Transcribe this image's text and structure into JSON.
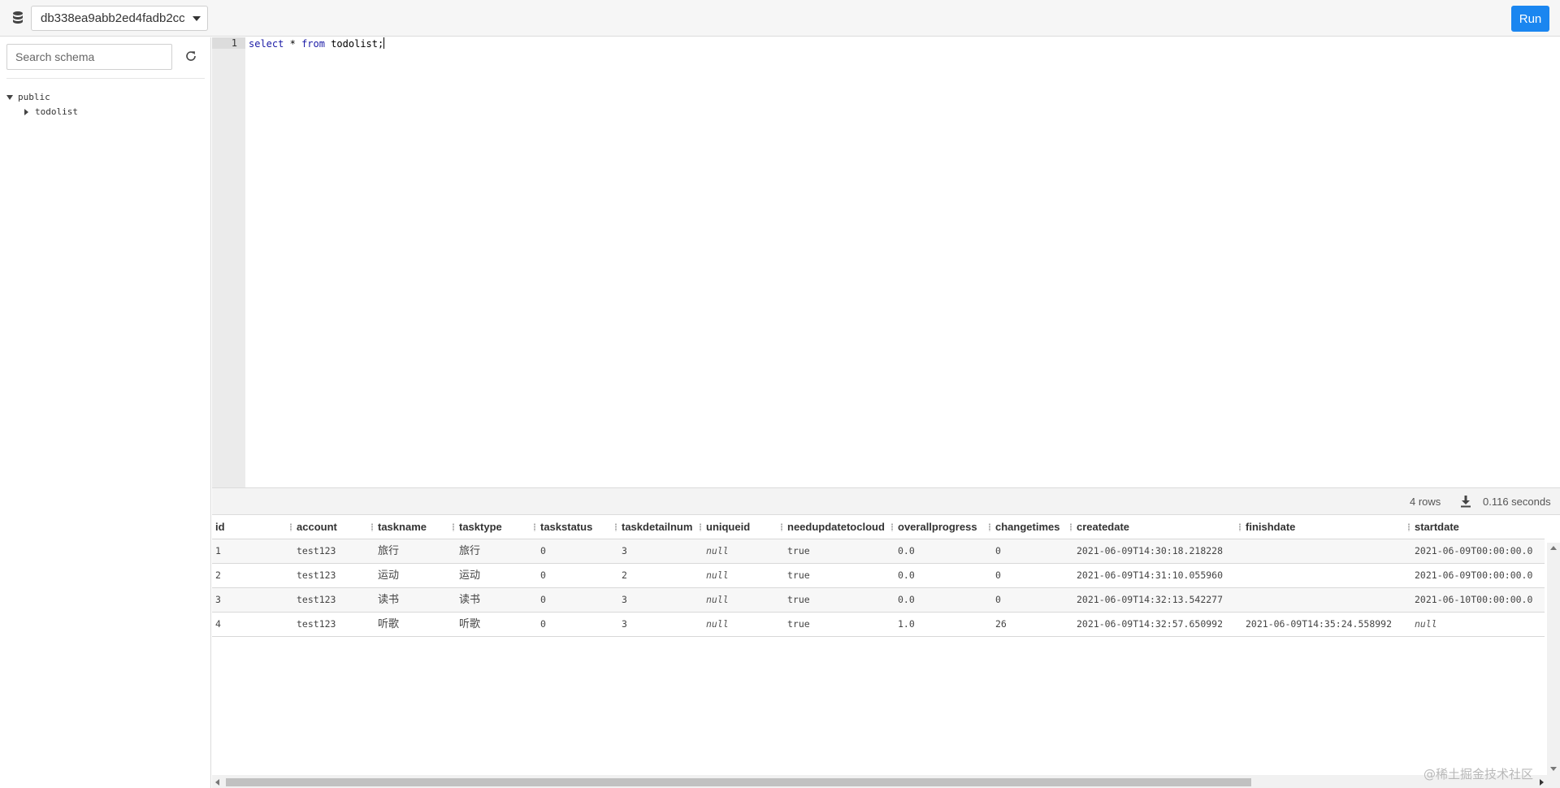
{
  "topbar": {
    "database_name": "db338ea9abb2ed4fadb2cc",
    "run_label": "Run",
    "accent_color": "#1a86f0"
  },
  "sidebar": {
    "search_placeholder": "Search schema",
    "tree": [
      {
        "label": "public",
        "expanded": true,
        "children": [
          {
            "label": "todolist",
            "expanded": false
          }
        ]
      }
    ]
  },
  "editor": {
    "line_number": "1",
    "query_keyword_select": "select",
    "query_star": "*",
    "query_keyword_from": "from",
    "query_table": "todolist;"
  },
  "results": {
    "row_count": "4 rows",
    "duration": "0.116 seconds",
    "columns": [
      "id",
      "account",
      "taskname",
      "tasktype",
      "taskstatus",
      "taskdetailnum",
      "uniqueid",
      "needupdatetocloud",
      "overallprogress",
      "changetimes",
      "createdate",
      "finishdate",
      "startdate"
    ],
    "rows": [
      [
        "1",
        "test123",
        "旅行",
        "旅行",
        "0",
        "3",
        "null",
        "true",
        "0.0",
        "0",
        "2021-06-09T14:30:18.218228",
        "",
        "2021-06-09T00:00:00.0"
      ],
      [
        "2",
        "test123",
        "运动",
        "运动",
        "0",
        "2",
        "null",
        "true",
        "0.0",
        "0",
        "2021-06-09T14:31:10.055960",
        "",
        "2021-06-09T00:00:00.0"
      ],
      [
        "3",
        "test123",
        "读书",
        "读书",
        "0",
        "3",
        "null",
        "true",
        "0.0",
        "0",
        "2021-06-09T14:32:13.542277",
        "",
        "2021-06-10T00:00:00.0"
      ],
      [
        "4",
        "test123",
        "听歌",
        "听歌",
        "0",
        "3",
        "null",
        "true",
        "1.0",
        "26",
        "2021-06-09T14:32:57.650992",
        "2021-06-09T14:35:24.558992",
        "null"
      ]
    ]
  },
  "watermark": "@稀土掘金技术社区"
}
